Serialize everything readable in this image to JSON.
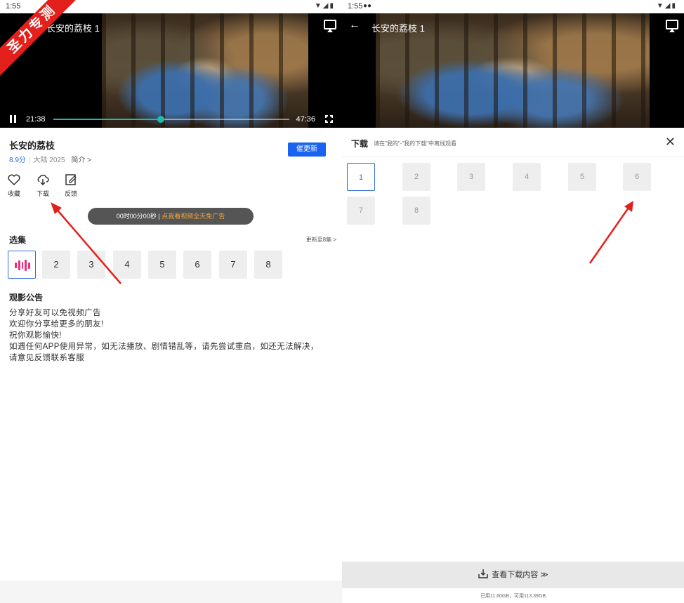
{
  "watermark": "圣力专测",
  "left": {
    "status": {
      "time": "1:55"
    },
    "video": {
      "title": "长安的荔枝 1",
      "current_time": "21:38",
      "total_time": "47:36",
      "progress_fraction": 0.455
    },
    "show": {
      "title": "长安的荔枝",
      "score": "8.9分",
      "region": "大陆",
      "year": "2025",
      "intro_label": "简介 >",
      "update_button": "催更新"
    },
    "actions": [
      {
        "label": "收藏",
        "icon": "heart-icon"
      },
      {
        "label": "下载",
        "icon": "cloud-download-icon"
      },
      {
        "label": "反馈",
        "icon": "edit-icon"
      }
    ],
    "toast": {
      "timer": "00时00分00秒",
      "separator": "|",
      "link": "点我看视频全天免广告"
    },
    "episodes": {
      "title": "选集",
      "more": "更新至8集 >",
      "items": [
        "",
        "2",
        "3",
        "4",
        "5",
        "6",
        "7",
        "8"
      ]
    },
    "notice": {
      "title": "观影公告",
      "lines": [
        "分享好友可以免视频广告",
        "欢迎你分享给更多的朋友!",
        "祝你观影愉快!",
        "如遇任何APP使用异常，如无法播放、剧情错乱等，请先尝试重启，如还无法解决，请意见反馈联系客服"
      ]
    }
  },
  "right": {
    "status": {
      "time": "1:55"
    },
    "video": {
      "title": "长安的荔枝 1"
    },
    "download": {
      "title": "下载",
      "hint": "请在\"我的\"-\"我的下载\"中离线观看",
      "episodes": [
        "1",
        "2",
        "3",
        "4",
        "5",
        "6",
        "7",
        "8"
      ],
      "view_button": "查看下载内容 ≫",
      "storage": "已用11.60GB，可用113.39GB"
    }
  },
  "colors": {
    "accent": "#1a63f0",
    "arrow": "#e3201b",
    "progress": "#21b8b0",
    "toast_link": "#f2a43c"
  }
}
